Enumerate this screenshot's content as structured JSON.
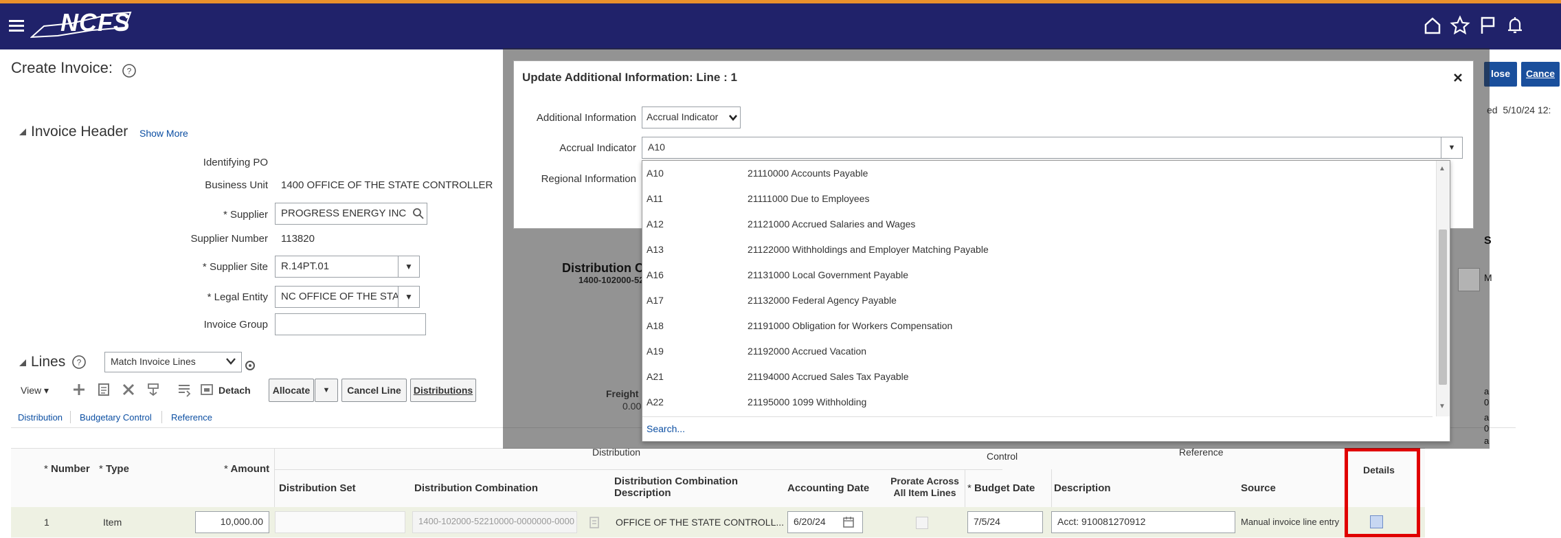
{
  "header": {
    "logo_text": "NCFS",
    "icons": [
      "menu-icon",
      "home-icon",
      "star-icon",
      "flag-icon",
      "bell-icon"
    ]
  },
  "page": {
    "title": "Create Invoice:",
    "right_buttons": {
      "close": "lose",
      "cancel": "Cance"
    },
    "right_text": "ed  5/10/24 12:"
  },
  "invoice_header": {
    "title": "Invoice Header",
    "show_more": "Show More",
    "identifying_po_label": "Identifying PO",
    "business_unit_label": "Business Unit",
    "business_unit_value": "1400 OFFICE OF THE STATE CONTROLLER",
    "supplier_label": "Supplier",
    "supplier_value": "PROGRESS ENERGY INC",
    "supplier_number_label": "Supplier Number",
    "supplier_number_value": "113820",
    "supplier_site_label": "Supplier Site",
    "supplier_site_value": "R.14PT.01",
    "legal_entity_label": "Legal Entity",
    "legal_entity_value": "NC OFFICE OF THE STATE",
    "invoice_group_label": "Invoice Group",
    "invoice_group_value": "",
    "required_mark": "*"
  },
  "lines": {
    "title": "Lines",
    "match_select": "Match Invoice Lines",
    "view_label": "View",
    "detach": "Detach",
    "allocate": "Allocate",
    "cancel_line": "Cancel Line",
    "distributions": "Distributions",
    "tabs": [
      "Distribution",
      "Budgetary Control",
      "Reference"
    ],
    "freight_label": "Freight",
    "freight_value": "0.00",
    "group_headers": {
      "distribution": "Distribution",
      "control": "Control",
      "reference": "Reference"
    },
    "columns": {
      "number": "Number",
      "type": "Type",
      "amount": "Amount",
      "distribution_set": "Distribution Set",
      "distribution_combination": "Distribution Combination",
      "dist_comb_desc_1": "Distribution Combination",
      "dist_comb_desc_2": "Description",
      "accounting_date": "Accounting Date",
      "prorate_1": "Prorate Across",
      "prorate_2": "All Item Lines",
      "budget_date": "Budget Date",
      "description": "Description",
      "source": "Source",
      "details": "Details"
    },
    "row": {
      "number": "1",
      "type": "Item",
      "amount": "10,000.00",
      "distribution_combination": "1400-102000-52210000-0000000-0000",
      "dist_comb_desc": "OFFICE OF THE STATE CONTROLL...",
      "accounting_date": "6/20/24",
      "budget_date": "7/5/24",
      "description": "Acct: 910081270912",
      "source": "Manual invoice line entry"
    }
  },
  "background_partial": {
    "distribution_co": "Distribution Co",
    "dist_value": "1400-102000-52",
    "right_s": "S",
    "right_m": "M",
    "right_frag": [
      "a",
      "0",
      "a",
      "0",
      "a",
      "0"
    ]
  },
  "modal": {
    "title": "Update Additional Information: Line : 1",
    "additional_information_label": "Additional Information",
    "additional_information_value": "Accrual Indicator",
    "accrual_indicator_label": "Accrual Indicator",
    "accrual_indicator_value": "A10",
    "regional_information_label": "Regional Information"
  },
  "dropdown": {
    "options": [
      {
        "code": "A10",
        "desc": "21110000 Accounts Payable"
      },
      {
        "code": "A11",
        "desc": "21111000 Due to Employees"
      },
      {
        "code": "A12",
        "desc": "21121000 Accrued Salaries and Wages"
      },
      {
        "code": "A13",
        "desc": "21122000 Withholdings and Employer Matching Payable"
      },
      {
        "code": "A16",
        "desc": "21131000 Local Government Payable"
      },
      {
        "code": "A17",
        "desc": "21132000 Federal Agency Payable"
      },
      {
        "code": "A18",
        "desc": "21191000 Obligation for Workers Compensation"
      },
      {
        "code": "A19",
        "desc": "21192000 Accrued Vacation"
      },
      {
        "code": "A21",
        "desc": "21194000 Accrued Sales Tax Payable"
      },
      {
        "code": "A22",
        "desc": "21195000 1099 Withholding"
      }
    ],
    "search": "Search..."
  },
  "colors": {
    "topbar": "#20226a",
    "accent_orange": "#e9912c",
    "highlight_red": "#e00000",
    "link_blue": "#0b4ea2"
  }
}
